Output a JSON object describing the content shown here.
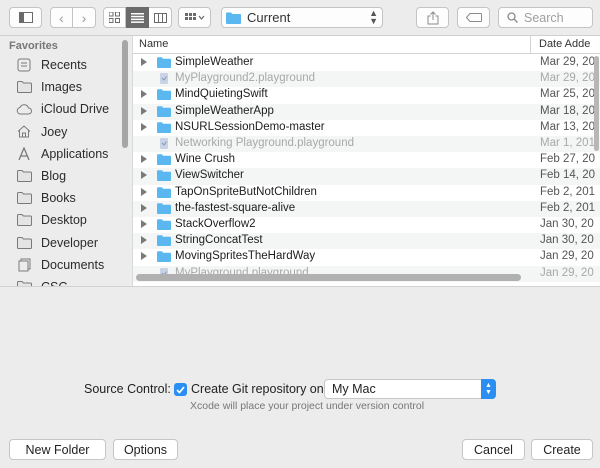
{
  "toolbar": {
    "location": "Current",
    "search_placeholder": "Search"
  },
  "sidebar": {
    "heading": "Favorites",
    "items": [
      {
        "label": "Recents",
        "icon": "recents-icon"
      },
      {
        "label": "Images",
        "icon": "folder-icon"
      },
      {
        "label": "iCloud Drive",
        "icon": "cloud-icon"
      },
      {
        "label": "Joey",
        "icon": "home-icon"
      },
      {
        "label": "Applications",
        "icon": "applications-icon"
      },
      {
        "label": "Blog",
        "icon": "folder-icon"
      },
      {
        "label": "Books",
        "icon": "folder-icon"
      },
      {
        "label": "Desktop",
        "icon": "folder-icon"
      },
      {
        "label": "Developer",
        "icon": "folder-icon"
      },
      {
        "label": "Documents",
        "icon": "documents-icon"
      },
      {
        "label": "CSC",
        "icon": "folder-icon"
      }
    ]
  },
  "list": {
    "col_name": "Name",
    "col_date": "Date Adde",
    "rows": [
      {
        "name": "SimpleWeather",
        "date": "Mar 29, 20",
        "kind": "folder"
      },
      {
        "name": "MyPlayground2.playground",
        "date": "Mar 29, 20",
        "kind": "playground"
      },
      {
        "name": "MindQuietingSwift",
        "date": "Mar 25, 20",
        "kind": "folder"
      },
      {
        "name": "SimpleWeatherApp",
        "date": "Mar 18, 20",
        "kind": "folder"
      },
      {
        "name": "NSURLSessionDemo-master",
        "date": "Mar 13, 20",
        "kind": "folder"
      },
      {
        "name": "Networking Playground.playground",
        "date": "Mar 1, 201",
        "kind": "playground"
      },
      {
        "name": "Wine Crush",
        "date": "Feb 27, 20",
        "kind": "folder"
      },
      {
        "name": "ViewSwitcher",
        "date": "Feb 14, 20",
        "kind": "folder"
      },
      {
        "name": "TapOnSpriteButNotChildren",
        "date": "Feb 2, 201",
        "kind": "folder"
      },
      {
        "name": "the-fastest-square-alive",
        "date": "Feb 2, 201",
        "kind": "folder"
      },
      {
        "name": "StackOverflow2",
        "date": "Jan 30, 20",
        "kind": "folder"
      },
      {
        "name": "StringConcatTest",
        "date": "Jan 30, 20",
        "kind": "folder"
      },
      {
        "name": "MovingSpritesTheHardWay",
        "date": "Jan 29, 20",
        "kind": "folder"
      },
      {
        "name": "MyPlayground.playground",
        "date": "Jan 29, 20",
        "kind": "playground"
      }
    ]
  },
  "options": {
    "source_control_label": "Source Control:",
    "git_checkbox_label": "Create Git repository on",
    "git_checked": true,
    "git_location": "My Mac",
    "hint": "Xcode will place your project under version control"
  },
  "buttons": {
    "new_folder": "New Folder",
    "options": "Options",
    "cancel": "Cancel",
    "create": "Create"
  },
  "colors": {
    "accent": "#2b8ef3",
    "folder": "#5ab7f0"
  }
}
